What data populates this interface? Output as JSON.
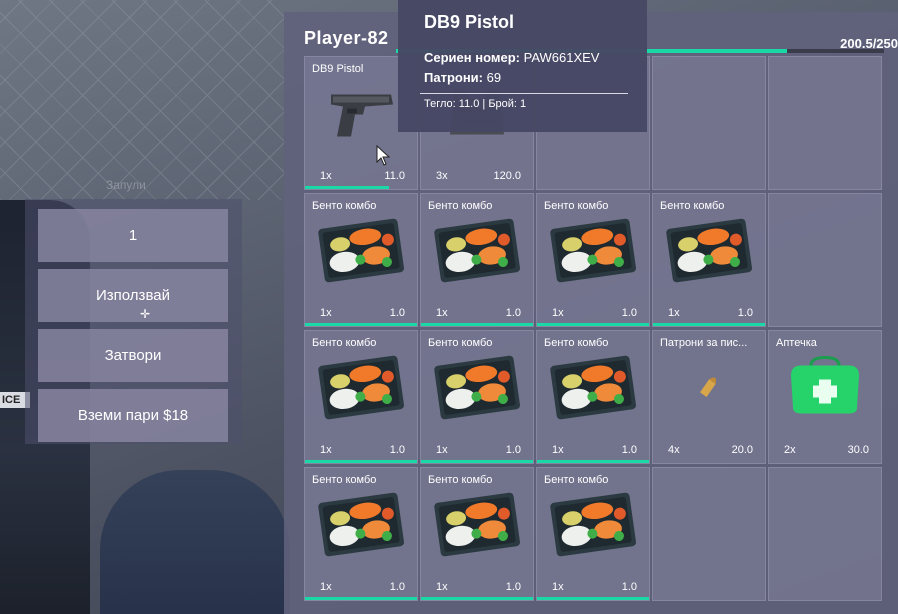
{
  "player": {
    "name": "Player-82",
    "weight": "200.5/250",
    "weight_fraction": 0.802
  },
  "tooltip": {
    "title": "DB9 Pistol",
    "serial_label": "Сериен номер:",
    "serial_value": "PAW661XEV",
    "ammo_label": "Патрони:",
    "ammo_value": "69",
    "footer": "Тегло: 11.0 | Брой: 1"
  },
  "background_text": "Запули",
  "actions": {
    "amount": "1",
    "use": "Използвай",
    "close": "Затвори",
    "take_money": "Вземи пари $18"
  },
  "slots": [
    {
      "name": "DB9 Pistol",
      "qty": "1x",
      "weight": "11.0",
      "icon": "pistol-icon",
      "durability": 0.75
    },
    {
      "name": "",
      "qty": "3x",
      "weight": "120.0",
      "icon": "armor-vest-icon",
      "durability": null
    },
    {
      "name": "",
      "qty": "",
      "weight": "",
      "icon": "",
      "durability": null
    },
    {
      "name": "",
      "qty": "",
      "weight": "",
      "icon": "",
      "durability": null
    },
    {
      "name": "",
      "qty": "",
      "weight": "",
      "icon": "",
      "durability": null
    },
    {
      "name": "Бенто комбо",
      "qty": "1x",
      "weight": "1.0",
      "icon": "bento-icon",
      "durability": 1
    },
    {
      "name": "Бенто комбо",
      "qty": "1x",
      "weight": "1.0",
      "icon": "bento-icon",
      "durability": 1
    },
    {
      "name": "Бенто комбо",
      "qty": "1x",
      "weight": "1.0",
      "icon": "bento-icon",
      "durability": 1
    },
    {
      "name": "Бенто комбо",
      "qty": "1x",
      "weight": "1.0",
      "icon": "bento-icon",
      "durability": 1
    },
    {
      "name": "",
      "qty": "",
      "weight": "",
      "icon": "",
      "durability": null
    },
    {
      "name": "Бенто комбо",
      "qty": "1x",
      "weight": "1.0",
      "icon": "bento-icon",
      "durability": 1
    },
    {
      "name": "Бенто комбо",
      "qty": "1x",
      "weight": "1.0",
      "icon": "bento-icon",
      "durability": 1
    },
    {
      "name": "Бенто комбо",
      "qty": "1x",
      "weight": "1.0",
      "icon": "bento-icon",
      "durability": 1
    },
    {
      "name": "Патрони за пис...",
      "qty": "4x",
      "weight": "20.0",
      "icon": "ammo-bullet-icon",
      "durability": null
    },
    {
      "name": "Аптечка",
      "qty": "2x",
      "weight": "30.0",
      "icon": "first-aid-kit-icon",
      "durability": null
    },
    {
      "name": "Бенто комбо",
      "qty": "1x",
      "weight": "1.0",
      "icon": "bento-icon",
      "durability": 1
    },
    {
      "name": "Бенто комбо",
      "qty": "1x",
      "weight": "1.0",
      "icon": "bento-icon",
      "durability": 1
    },
    {
      "name": "Бенто комбо",
      "qty": "1x",
      "weight": "1.0",
      "icon": "bento-icon",
      "durability": 1
    },
    {
      "name": "",
      "qty": "",
      "weight": "",
      "icon": "",
      "durability": null
    },
    {
      "name": "",
      "qty": "",
      "weight": "",
      "icon": "",
      "durability": null
    }
  ],
  "colors": {
    "accent": "#1bd9a6",
    "panel": "#60627c",
    "tooltip": "#464864"
  }
}
